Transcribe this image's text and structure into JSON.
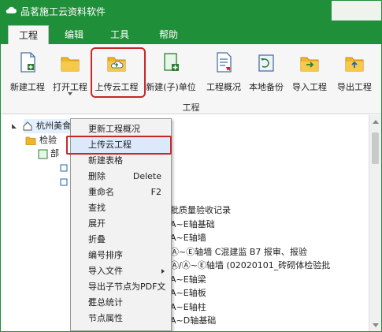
{
  "titlebar": {
    "title": "品茗施工云资料软件"
  },
  "menu": {
    "tabs": [
      "工程",
      "编辑",
      "工具",
      "帮助"
    ],
    "active": "工程"
  },
  "ribbon": {
    "buttons": [
      "新建工程",
      "打开工程",
      "上传云工程",
      "新建(子)单位",
      "工程概况",
      "本地备份",
      "导入工程",
      "导出工程"
    ],
    "group_label": "工程"
  },
  "tree": {
    "root_label": "杭州美食",
    "child_label": "检验",
    "sub_label": "部"
  },
  "content_rows": [
    "批质量验收记录",
    "A~E轴基础",
    "A~E轴墙",
    "Ⓐ~Ⓔ轴墙 C混建监 B7 报审、报验",
    "Ⓐ/Ⓐ~Ⓔ轴墙 (02020101_砖砌体检验批",
    "A~E轴梁",
    "A~E轴板",
    "A~E轴柱",
    "A~D轴基础"
  ],
  "context_menu": {
    "items": [
      {
        "label": "更新工程概况",
        "shortcut": "",
        "submenu": false
      },
      {
        "label": "上传云工程",
        "shortcut": "",
        "submenu": false
      },
      {
        "label": "新建表格",
        "shortcut": "",
        "submenu": false
      },
      {
        "label": "删除",
        "shortcut": "Delete",
        "submenu": false
      },
      {
        "label": "重命名",
        "shortcut": "F2",
        "submenu": false
      },
      {
        "label": "查找",
        "shortcut": "",
        "submenu": false
      },
      {
        "label": "展开",
        "shortcut": "",
        "submenu": false
      },
      {
        "label": "折叠",
        "shortcut": "",
        "submenu": false
      },
      {
        "label": "编号排序",
        "shortcut": "",
        "submenu": false
      },
      {
        "label": "导入文件",
        "shortcut": "",
        "submenu": true
      },
      {
        "label": "导出子节点为PDF文件",
        "shortcut": "",
        "submenu": false
      },
      {
        "label": "汇总统计",
        "shortcut": "",
        "submenu": false
      },
      {
        "label": "节点属性",
        "shortcut": "",
        "submenu": false
      }
    ]
  },
  "colors": {
    "brand": "#1f8f3a",
    "highlight_box": "#c62828",
    "menu_hover": "#dbe9fb"
  }
}
